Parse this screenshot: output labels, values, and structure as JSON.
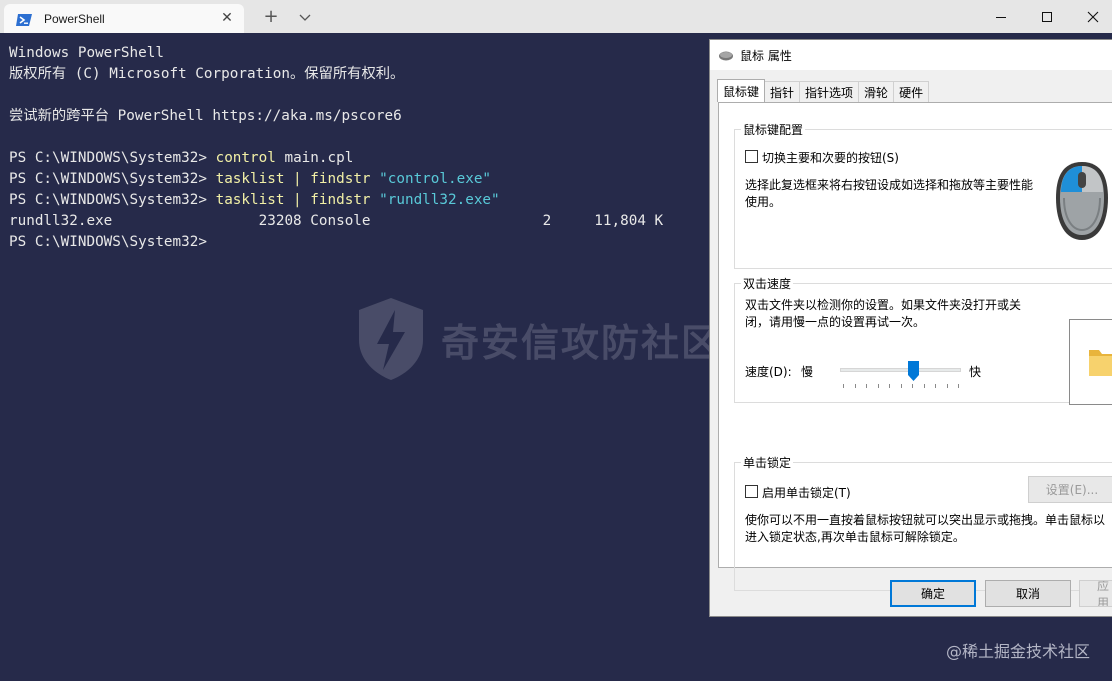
{
  "window": {
    "tab_title": "PowerShell",
    "close_tab": "✕",
    "new_tab": "+",
    "minimize": "—",
    "maximize": "☐",
    "close": "✕"
  },
  "terminal": {
    "lines": [
      {
        "prompt": "Windows PowerShell",
        "cmd": "",
        "rest": "",
        "str": ""
      },
      {
        "prompt": "版权所有 (C) Microsoft Corporation。保留所有权利。",
        "cmd": "",
        "rest": "",
        "str": ""
      },
      {
        "prompt": "",
        "cmd": "",
        "rest": "",
        "str": ""
      },
      {
        "prompt": "尝试新的跨平台 PowerShell https://aka.ms/pscore6",
        "cmd": "",
        "rest": "",
        "str": ""
      },
      {
        "prompt": "",
        "cmd": "",
        "rest": "",
        "str": ""
      },
      {
        "prompt": "PS C:\\WINDOWS\\System32> ",
        "cmd": "control",
        "rest": " main.cpl",
        "str": ""
      },
      {
        "prompt": "PS C:\\WINDOWS\\System32> ",
        "cmd": "tasklist | findstr",
        "rest": " ",
        "str": "\"control.exe\""
      },
      {
        "prompt": "PS C:\\WINDOWS\\System32> ",
        "cmd": "tasklist | findstr",
        "rest": " ",
        "str": "\"rundll32.exe\""
      },
      {
        "prompt": "rundll32.exe                 23208 Console                    2     11,804 K",
        "cmd": "",
        "rest": "",
        "str": ""
      },
      {
        "prompt": "PS C:\\WINDOWS\\System32>",
        "cmd": "",
        "rest": "",
        "str": ""
      }
    ]
  },
  "watermark": {
    "text": "奇安信攻防社区",
    "credit": "@稀土掘金技术社区"
  },
  "dialog": {
    "title": "鼠标 属性",
    "tabs": [
      "鼠标键",
      "指针",
      "指针选项",
      "滑轮",
      "硬件"
    ],
    "buttons_group": {
      "label": "鼠标键配置",
      "checkbox_label": "切换主要和次要的按钮(S)",
      "checked": false,
      "description": "选择此复选框来将右按钮设成如选择和拖放等主要性能使用。"
    },
    "double_click": {
      "label": "双击速度",
      "description": "双击文件夹以检测你的设置。如果文件夹没打开或关闭，请用慢一点的设置再试一次。",
      "speed_label": "速度(D):",
      "slow": "慢",
      "fast": "快",
      "speed_value": 0.6
    },
    "click_lock": {
      "label": "单击锁定",
      "checkbox_label": "启用单击锁定(T)",
      "checked": false,
      "settings_button": "设置(E)...",
      "description": "使你可以不用一直按着鼠标按钮就可以突出显示或拖拽。单击鼠标以进入锁定状态,再次单击鼠标可解除锁定。"
    },
    "ok": "确定",
    "cancel": "取消",
    "apply": "应用"
  },
  "colors": {
    "terminal_bg": "#262a4a",
    "command": "#f2f0a6",
    "string": "#59c9d8",
    "accent": "#0078d7"
  }
}
